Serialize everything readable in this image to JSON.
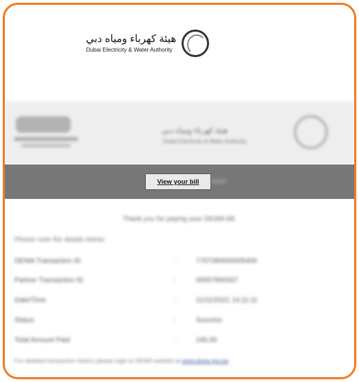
{
  "header": {
    "logo_ar": "هيئة كهرباء ومياه دبي",
    "logo_en": "Dubai Electricity & Water Authority"
  },
  "banner": {
    "dewa_ar": "هيئة كهرباء ومياه دبي",
    "dewa_en": "Dubai Electricity & Water Authority"
  },
  "action": {
    "view_bill_label": "View your bill"
  },
  "message": {
    "thanks": "Thank you for paying your DEWA bill.",
    "details_heading": "Please note the details below:"
  },
  "details": [
    {
      "label": "DEWA Transaction ID",
      "sep": ":",
      "value": "7707390000005400"
    },
    {
      "label": "Partner Transaction ID",
      "sep": ":",
      "value": "00057800347"
    },
    {
      "label": "Date/Time",
      "sep": ":",
      "value": "21/11/2021 14:11:11"
    },
    {
      "label": "Status",
      "sep": ":",
      "value": "Success"
    },
    {
      "label": "Total Amount Paid",
      "sep": ":",
      "value": "245.00"
    }
  ],
  "footer_note": {
    "text": "For detailed transaction history please login to DEWA website at",
    "link": "www.dewa.gov.ae"
  },
  "colors": {
    "frame": "#f07a22",
    "bar": "#777777"
  }
}
